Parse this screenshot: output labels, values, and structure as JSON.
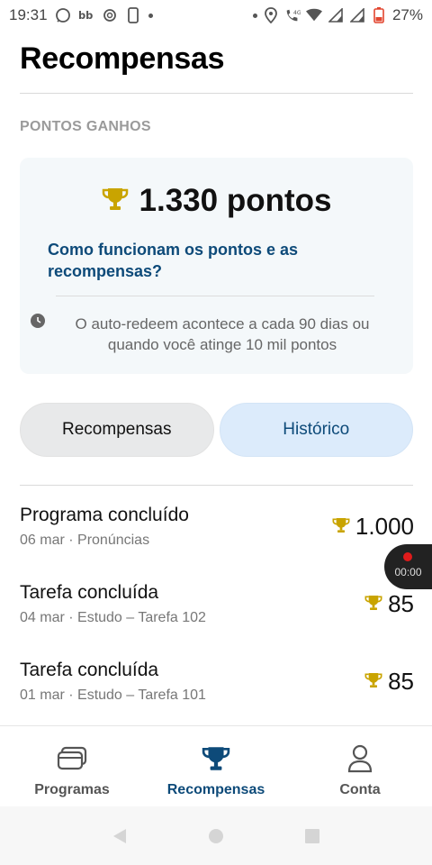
{
  "status_bar": {
    "time": "19:31",
    "battery": "27%",
    "network": "4G"
  },
  "page": {
    "title": "Recompensas"
  },
  "points": {
    "section_label": "PONTOS GANHOS",
    "value": "1.330 pontos",
    "how_link": "Como funcionam os pontos e as recompensas?",
    "auto_redeem_text": "O auto-redeem acontece a cada 90 dias ou quando você atinge 10 mil pontos"
  },
  "tabs": {
    "rewards_label": "Recompensas",
    "history_label": "Histórico",
    "active": "history"
  },
  "history": [
    {
      "title": "Programa concluído",
      "subtitle": "06 mar · Pronúncias",
      "points": "1.000"
    },
    {
      "title": "Tarefa concluída",
      "subtitle": "04 mar · Estudo – Tarefa 102",
      "points": "85"
    },
    {
      "title": "Tarefa concluída",
      "subtitle": "01 mar · Estudo – Tarefa 101",
      "points": "85"
    }
  ],
  "recording": {
    "time": "00:00"
  },
  "bottom_nav": {
    "programs_label": "Programas",
    "rewards_label": "Recompensas",
    "account_label": "Conta",
    "active": "rewards"
  },
  "colors": {
    "brand_blue": "#0d4a79",
    "trophy_gold": "#c9a400",
    "tab_active_bg": "#dcebfb",
    "card_bg": "#f4f8fa"
  },
  "icons": {
    "trophy": "trophy-icon",
    "clock": "clock-icon",
    "programs": "cards-icon",
    "account": "person-icon"
  }
}
